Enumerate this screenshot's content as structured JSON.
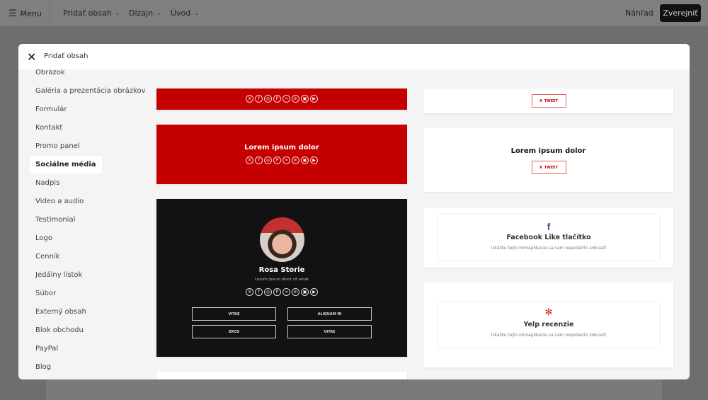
{
  "topbar": {
    "menu": "Menu",
    "add_content": "Pridať obsah",
    "design": "Dizajn",
    "home": "Úvod",
    "preview": "Náhľad",
    "publish": "Zverejniť"
  },
  "modal": {
    "title": "Pridať obsah"
  },
  "sidebar": {
    "active": "Sociálne média",
    "items": [
      "Obrázok",
      "Galéria a prezentácia obrázkov",
      "Formulár",
      "Kontakt",
      "Promo panel",
      "Sociálne média",
      "Nadpis",
      "Video a audio",
      "Testimonial",
      "Logo",
      "Cenník",
      "Jedálny lístok",
      "Súbor",
      "Externý obsah",
      "Blok obchodu",
      "PayPal",
      "Blog"
    ]
  },
  "social_icons": [
    "X",
    "f",
    "◎",
    "P",
    "≈",
    "in",
    "▣",
    "▶"
  ],
  "cards": {
    "red_title": "Lorem ipsum dolor",
    "profile": {
      "name": "Rosa Storie",
      "subtitle": "Lorum Ipsum dolor sit amet",
      "buttons": [
        "VITAE",
        "ALIQUAM IN",
        "EROS",
        "VITAE"
      ]
    },
    "tweet_label": "TWEET",
    "tweet_title": "Lorem ipsum dolor",
    "facebook": {
      "title": "Facebook Like tlačítko",
      "message": "Ukážku tejto miniaplikácie sa nám nepodarilo zobraziť"
    },
    "yelp": {
      "title": "Yelp recenzie",
      "message": "Ukážku tejto miniaplikácie sa nám nepodarilo zobraziť"
    }
  },
  "colors": {
    "accent": "#c40000",
    "dark": "#121214",
    "facebook": "#3b5998"
  }
}
